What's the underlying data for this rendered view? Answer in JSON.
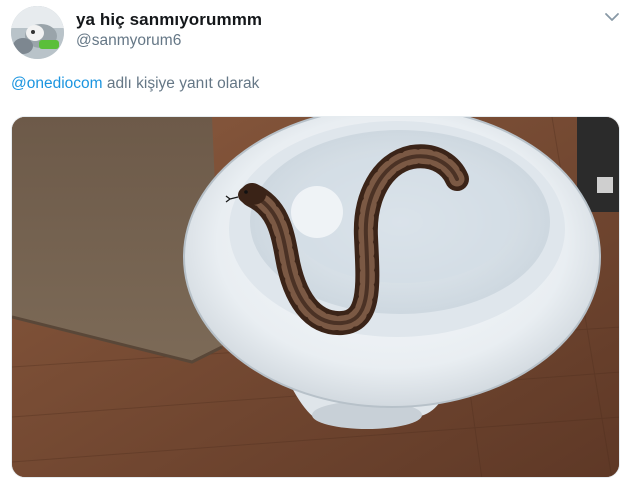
{
  "tweet": {
    "display_name": "ya hiç sanmıyorummm",
    "handle": "@sanmyorum6",
    "reply_context": {
      "mention": "@onediocom",
      "suffix": " adlı kişiye yanıt olarak"
    },
    "menu_icon": "chevron-down-icon",
    "avatar_icon": "profile-photo",
    "media_subject": "snake-in-toilet-photo"
  },
  "colors": {
    "name": "#14171a",
    "secondary_text": "#657786",
    "link": "#1b95e0",
    "background": "#ffffff"
  }
}
